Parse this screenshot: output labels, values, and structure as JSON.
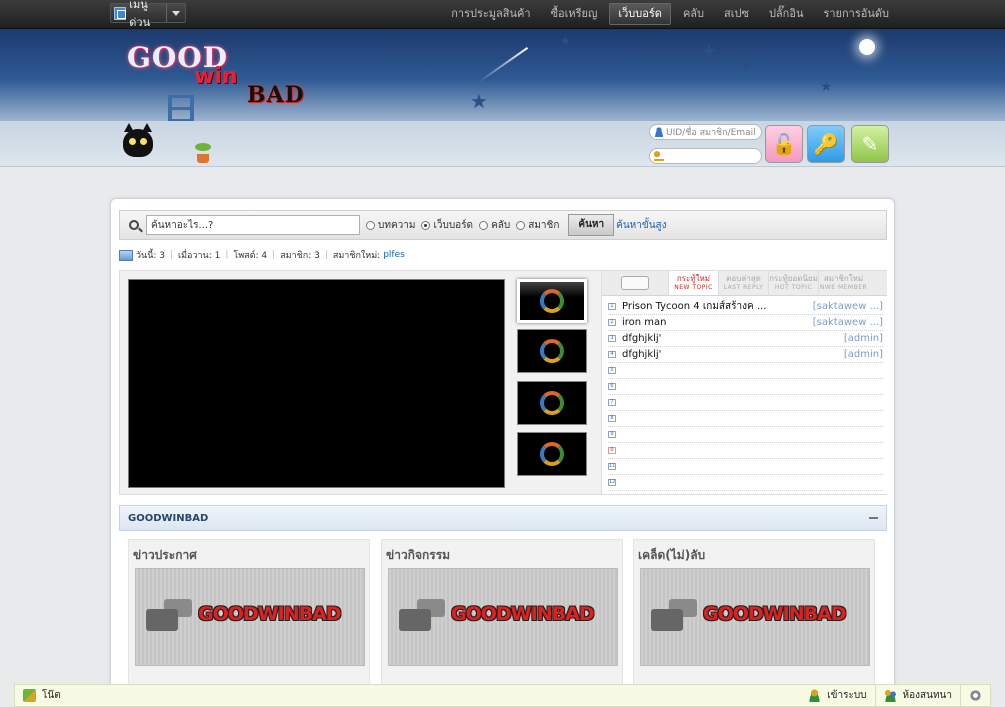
{
  "topbar": {
    "quick_menu_label": "เมนูด่วน",
    "nav": [
      "การประมูลสินค้า",
      "ซื้อเหรียญ",
      "เว็บบอร์ด",
      "คลับ",
      "สเปซ",
      "ปลั๊กอิน",
      "รายการอันดับ"
    ],
    "active_nav": "เว็บบอร์ด"
  },
  "header": {
    "logo_parts": [
      "GOOD",
      "win",
      "BAD"
    ]
  },
  "login": {
    "username_placeholder": "UID/ชื่อ สมาชิก/Email",
    "password_placeholder": ""
  },
  "search": {
    "placeholder": "ค้นหาอะไร...?",
    "options": [
      "บทความ",
      "เว็บบอร์ด",
      "คลับ",
      "สมาชิก"
    ],
    "selected_option": "เว็บบอร์ด",
    "button_label": "ค้นหา",
    "advanced_link": "ค้นหาขั้นสูง"
  },
  "stats": {
    "today": "วันนี้: 3",
    "yesterday": "เมื่อวาน: 1",
    "posts": "โพสต์: 4",
    "members": "สมาชิก: 3",
    "new_member_label": "สมาชิกใหม่:",
    "new_member": "plfes"
  },
  "recent": {
    "tabs": [
      {
        "th": "กระทู้ใหม่",
        "en": "NEW TOPIC",
        "active": true
      },
      {
        "th": "ตอบล่าสุด",
        "en": "LAST REPLY",
        "active": false
      },
      {
        "th": "กระทู้ยอดนิยม",
        "en": "HOT TOPIC",
        "active": false
      },
      {
        "th": "สมาชิกใหม่",
        "en": "NWE MEMBER",
        "active": false
      }
    ],
    "rows": [
      {
        "num": "1",
        "title": "Prison Tycoon 4 เกมส์สร้างค ...",
        "author": "[saktawew ...]"
      },
      {
        "num": "2",
        "title": "iron man",
        "author": "[saktawew ...]"
      },
      {
        "num": "3",
        "title": "dfghjklj'",
        "author": "[admin]"
      },
      {
        "num": "4",
        "title": "dfghjklj'",
        "author": "[admin]"
      },
      {
        "num": "5",
        "title": "",
        "author": ""
      },
      {
        "num": "6",
        "title": "",
        "author": ""
      },
      {
        "num": "7",
        "title": "",
        "author": ""
      },
      {
        "num": "8",
        "title": "",
        "author": ""
      },
      {
        "num": "9",
        "title": "",
        "author": ""
      },
      {
        "num": "0",
        "title": "",
        "author": ""
      },
      {
        "num": "11",
        "title": "",
        "author": ""
      },
      {
        "num": "12",
        "title": "",
        "author": ""
      }
    ]
  },
  "category": {
    "title": "GOODWINBAD",
    "cards": [
      {
        "title": "ข่าวประกาศ",
        "image_text": "GOODWINBAD"
      },
      {
        "title": "ข่าวกิจกรรม",
        "image_text": "GOODWINBAD"
      },
      {
        "title": "เคล็ด(ไม่)ลับ",
        "image_text": "GOODWINBAD"
      }
    ]
  },
  "bottombar": {
    "tools_label": "โน๊ต",
    "login_label": "เข้าระบบ",
    "chat_label": "ห้องสนทนา"
  },
  "colors": {
    "accent_blue": "#1a5fb4",
    "new_topic_red": "#c62828",
    "header_dark": "#1f1f1f"
  }
}
